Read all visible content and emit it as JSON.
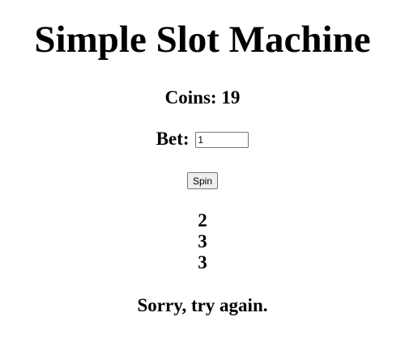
{
  "title": "Simple Slot Machine",
  "coins": {
    "label": "Coins:",
    "value": "19"
  },
  "bet": {
    "label": "Bet:",
    "value": "1"
  },
  "spin_button": {
    "label": "Spin"
  },
  "reels": [
    "2",
    "3",
    "3"
  ],
  "result_message": "Sorry, try again."
}
